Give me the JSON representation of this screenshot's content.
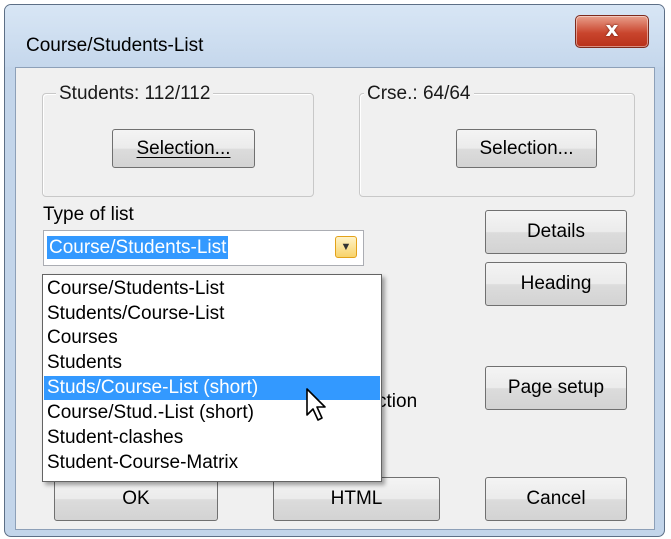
{
  "window": {
    "title": "Course/Students-List",
    "close_label": "x"
  },
  "students_group": {
    "legend": "Students: 112/112",
    "selection_button": "Selection..."
  },
  "course_group": {
    "legend": "Crse.: 64/64",
    "selection_button": "Selection..."
  },
  "type_of_list": {
    "label": "Type of list",
    "selected": "Course/Students-List",
    "options": [
      "Course/Students-List",
      "Students/Course-List",
      "Courses",
      "Students",
      "Studs/Course-List (short)",
      "Course/Stud.-List (short)",
      "Student-clashes",
      "Student-Course-Matrix"
    ],
    "highlighted_index": 4
  },
  "side_buttons": {
    "details": "Details",
    "heading": "Heading",
    "page_setup": "Page setup"
  },
  "partial_text": "ction",
  "footer": {
    "ok": "OK",
    "html": "HTML",
    "cancel": "Cancel"
  },
  "icons": {
    "dropdown": "chevron-down-icon",
    "close": "close-icon",
    "cursor": "mouse-pointer-icon"
  },
  "colors": {
    "selection": "#3399ff",
    "close_button": "#c9452d",
    "title_bar": "#c3d5ea"
  }
}
